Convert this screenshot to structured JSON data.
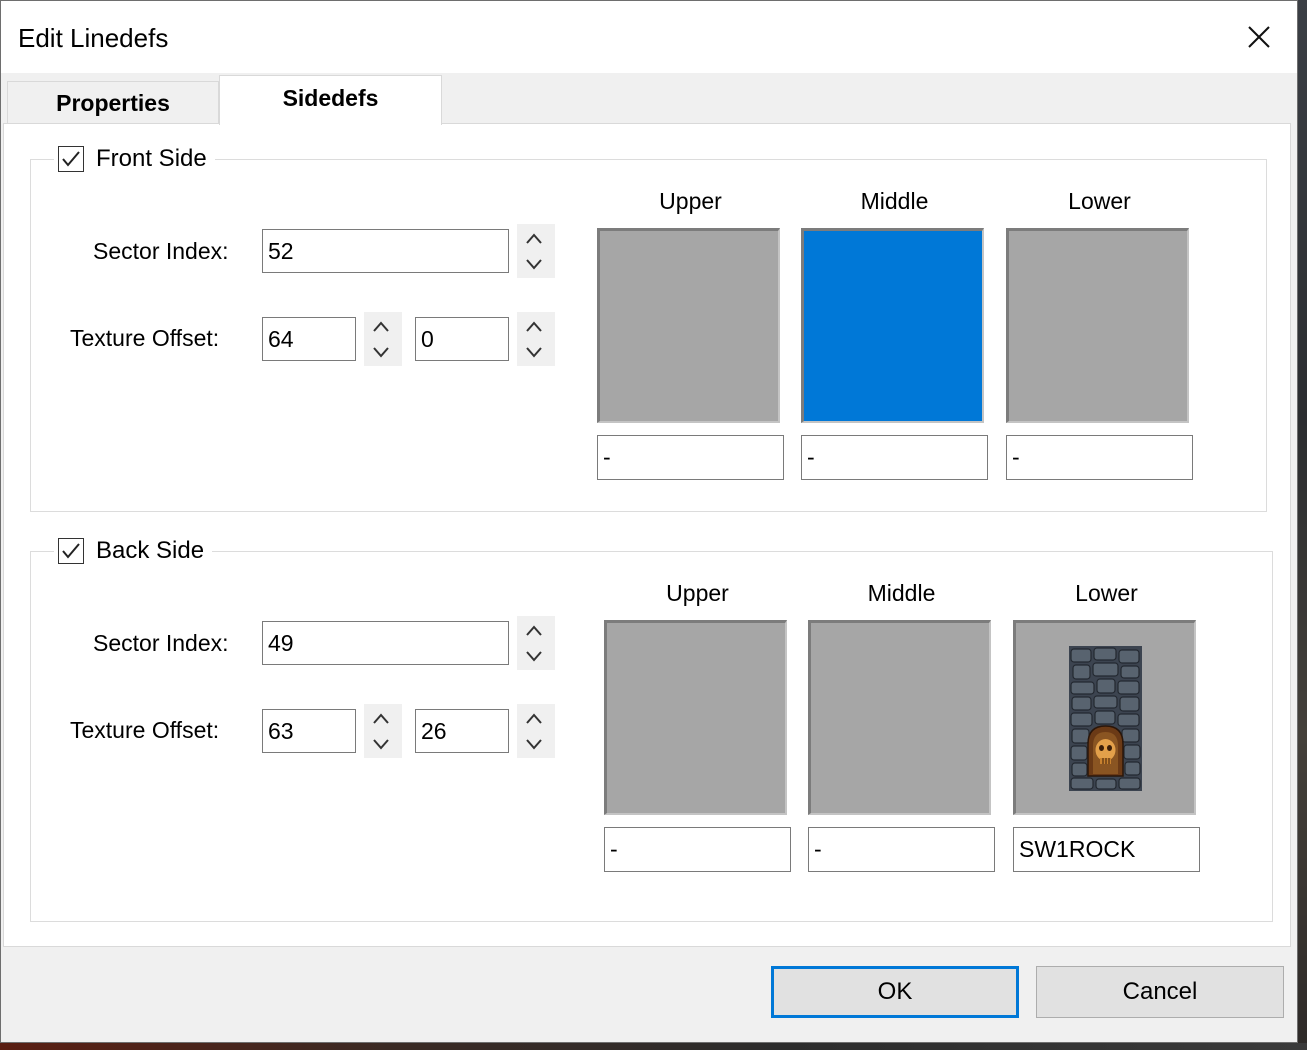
{
  "window": {
    "title": "Edit Linedefs",
    "close_icon": "close-icon"
  },
  "tabs": [
    {
      "label": "Properties",
      "selected": false
    },
    {
      "label": "Sidedefs",
      "selected": true
    }
  ],
  "front_side": {
    "label": "Front Side",
    "checked": true,
    "sector_index_label": "Sector Index:",
    "sector_index": "52",
    "texture_offset_label": "Texture Offset:",
    "offset_x": "64",
    "offset_y": "0",
    "columns": [
      {
        "label": "Upper",
        "texture": "-",
        "selected": false
      },
      {
        "label": "Middle",
        "texture": "-",
        "selected": true
      },
      {
        "label": "Lower",
        "texture": "-",
        "selected": false
      }
    ]
  },
  "back_side": {
    "label": "Back Side",
    "checked": true,
    "sector_index_label": "Sector Index:",
    "sector_index": "49",
    "texture_offset_label": "Texture Offset:",
    "offset_x": "63",
    "offset_y": "26",
    "columns": [
      {
        "label": "Upper",
        "texture": "-",
        "selected": false
      },
      {
        "label": "Middle",
        "texture": "-",
        "selected": false
      },
      {
        "label": "Lower",
        "texture": "SW1ROCK",
        "selected": false
      }
    ]
  },
  "buttons": {
    "ok": "OK",
    "cancel": "Cancel"
  },
  "colors": {
    "selection": "#0078d7",
    "texture_placeholder": "#a6a6a6",
    "panel": "#ffffff",
    "dialog": "#f0f0f0"
  }
}
